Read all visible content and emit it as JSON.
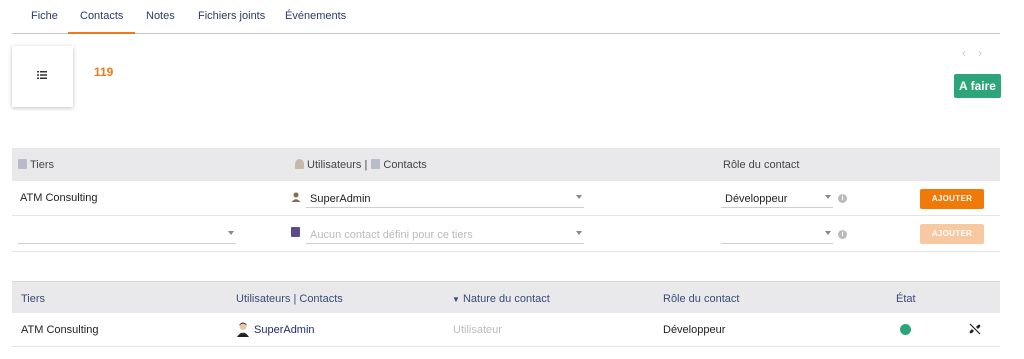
{
  "tabs": [
    {
      "label": "Fiche",
      "active": false
    },
    {
      "label": "Contacts",
      "active": true
    },
    {
      "label": "Notes",
      "active": false
    },
    {
      "label": "Fichiers joints",
      "active": false
    },
    {
      "label": "Événements",
      "active": false
    }
  ],
  "header": {
    "ref": "119",
    "status": "A faire",
    "status_color": "#2ca57a",
    "nav_prev": "‹",
    "nav_next": "›"
  },
  "add_form": {
    "headers": {
      "tiers": "Tiers",
      "users_contacts": "Utilisateurs | ",
      "contacts": "Contacts",
      "role": "Rôle du contact"
    },
    "row_user": {
      "tiers": "ATM Consulting",
      "user": "SuperAdmin",
      "role": "Développeur",
      "button": "AJOUTER"
    },
    "row_contact": {
      "tiers": "",
      "contact_placeholder": "Aucun contact défini pour ce tiers",
      "role": "",
      "button": "AJOUTER"
    }
  },
  "list": {
    "headers": {
      "tiers": "Tiers",
      "users_contacts": "Utilisateurs | Contacts",
      "nature": "Nature du contact",
      "role": "Rôle du contact",
      "etat": "État"
    },
    "rows": [
      {
        "tiers": "ATM Consulting",
        "user": "SuperAdmin",
        "nature": "Utilisateur",
        "role": "Développeur",
        "etat_color": "#2ca57a"
      }
    ]
  },
  "colors": {
    "accent": "#f07a1a",
    "button_primary": "#f07a08",
    "button_disabled": "#f8c9a0",
    "header_bg": "#e9e9eb"
  }
}
